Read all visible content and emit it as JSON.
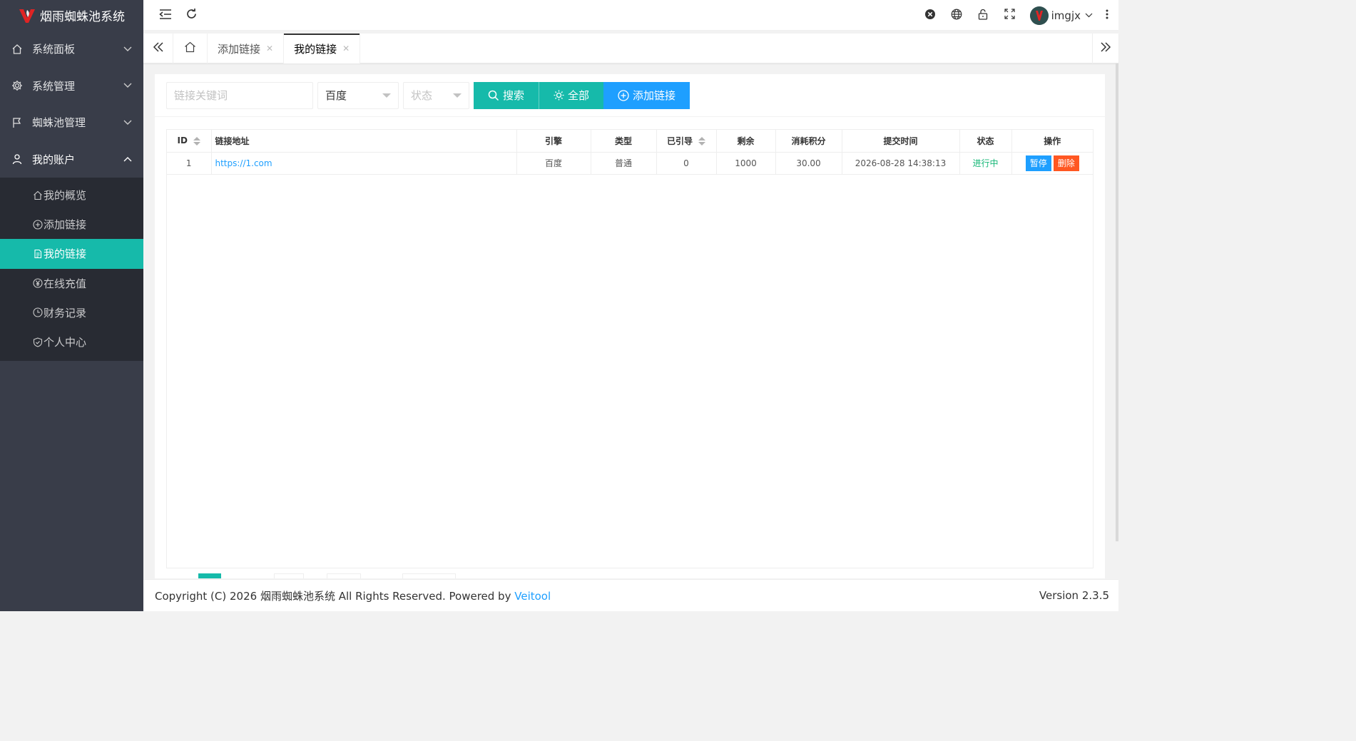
{
  "app": {
    "title": "烟雨蜘蛛池系统"
  },
  "sidebar": {
    "menus": [
      {
        "label": "系统面板",
        "icon": "home-icon",
        "open": false
      },
      {
        "label": "系统管理",
        "icon": "gear-icon",
        "open": false
      },
      {
        "label": "蜘蛛池管理",
        "icon": "flag-icon",
        "open": false
      },
      {
        "label": "我的账户",
        "icon": "user-icon",
        "open": true
      }
    ],
    "submenu": [
      {
        "label": "我的概览",
        "icon": "home-outline-icon"
      },
      {
        "label": "添加链接",
        "icon": "plus-circle-icon"
      },
      {
        "label": "我的链接",
        "icon": "document-icon",
        "active": true
      },
      {
        "label": "在线充值",
        "icon": "yuan-circle-icon"
      },
      {
        "label": "财务记录",
        "icon": "clock-icon"
      },
      {
        "label": "个人中心",
        "icon": "shield-check-icon"
      }
    ]
  },
  "header": {
    "username": "imgjx"
  },
  "tabs": [
    {
      "label": "添加链接"
    },
    {
      "label": "我的链接",
      "active": true
    }
  ],
  "toolbar": {
    "keyword_placeholder": "链接关键词",
    "engine_value": "百度",
    "status_placeholder": "状态",
    "search_label": "搜索",
    "all_label": "全部",
    "add_label": "添加链接"
  },
  "table": {
    "columns": [
      "ID",
      "链接地址",
      "引擎",
      "类型",
      "已引导",
      "剩余",
      "消耗积分",
      "提交时间",
      "状态",
      "操作"
    ],
    "rows": [
      {
        "id": "1",
        "url": "https://1.com",
        "engine": "百度",
        "type": "普通",
        "guided": "0",
        "remaining": "1000",
        "points": "30.00",
        "time": "2026-08-28 14:38:13",
        "status": "进行中",
        "pause": "暂停",
        "delete": "删除"
      }
    ]
  },
  "footer": {
    "copyright": "Copyright (C) 2026 烟雨蜘蛛池系统 All Rights Reserved. Powered by",
    "powered": "Veitool",
    "version": "Version 2.3.5"
  },
  "colors": {
    "sidebar": "#393d49",
    "submenu": "#282b33",
    "accent": "#16baaa",
    "blue": "#1e9fff",
    "danger": "#ff5722",
    "running": "#16b777"
  }
}
